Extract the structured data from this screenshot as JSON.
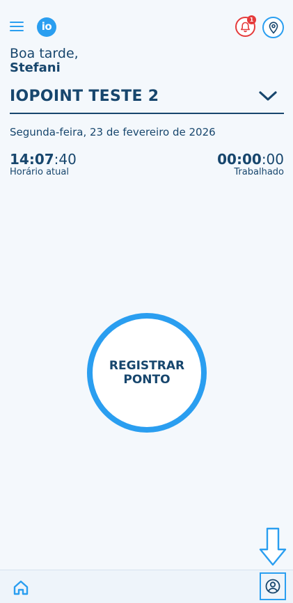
{
  "header": {
    "logo_text": "io",
    "notification_count": "1"
  },
  "greeting": {
    "line1": "Boa tarde,",
    "name": "Stefani"
  },
  "company": {
    "name": "IOPOINT TESTE 2"
  },
  "date": "Segunda-feira, 23 de fevereiro de 2026",
  "clock_current": {
    "hm": "14:07",
    "sec": ":40",
    "label": "Horário atual"
  },
  "clock_worked": {
    "hm": "00:00",
    "sec": ":00",
    "label": "Trabalhado"
  },
  "register_button": {
    "line1": "REGISTRAR",
    "line2": "PONTO"
  },
  "colors": {
    "accent": "#2a9ef0",
    "primary_text": "#17466d",
    "alert": "#e53b3b",
    "background": "#f4f8fc"
  },
  "icons": [
    "menu-icon",
    "bell-icon",
    "location-pin-icon",
    "chevron-down-icon",
    "down-arrow-icon",
    "home-icon",
    "user-profile-icon"
  ]
}
